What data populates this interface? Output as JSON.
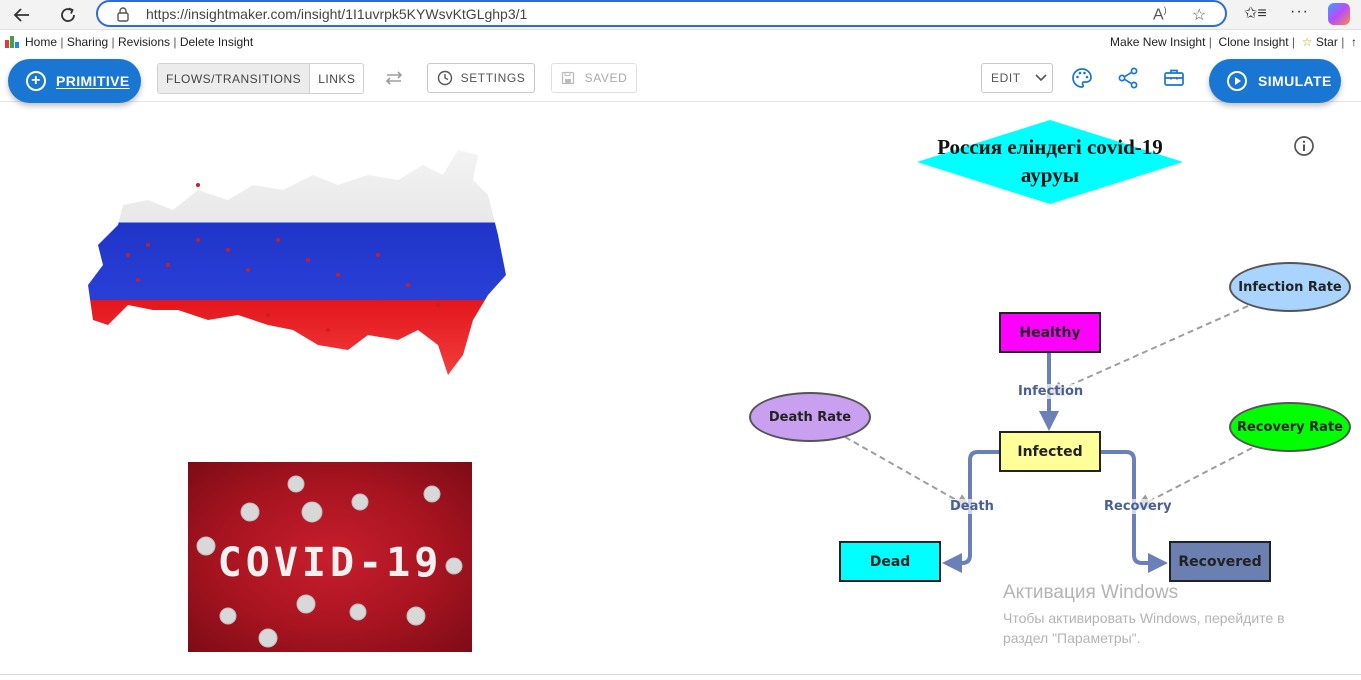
{
  "browser": {
    "url": "https://insightmaker.com/insight/1I1uvrpk5KYWsvKtGLghp3/1"
  },
  "links": {
    "left": [
      "Home",
      "Sharing",
      "Revisions",
      "Delete Insight"
    ],
    "right": [
      "Make New Insight",
      "Clone Insight",
      "Star"
    ],
    "star_symbol": "☆",
    "trailing": "↑"
  },
  "toolbar": {
    "primitive_label": "PRIMITIVE",
    "flows_label": "FLOWS/TRANSITIONS",
    "links_label": "LINKS",
    "settings_label": "SETTINGS",
    "saved_label": "SAVED",
    "edit_label": "EDIT",
    "simulate_label": "SIMULATE",
    "accent": "#1976d2"
  },
  "diagram": {
    "title": "Россия еліндегі covid-19 ауруы",
    "title_color": "#00ffff",
    "stocks": {
      "healthy": {
        "label": "Healthy",
        "color": "#ff00ff"
      },
      "infected": {
        "label": "Infected",
        "color": "#ffff99"
      },
      "dead": {
        "label": "Dead",
        "color": "#00ffff"
      },
      "recovered": {
        "label": "Recovered",
        "color": "#6b7fb0"
      }
    },
    "variables": {
      "infection_rate": {
        "label": "Infection Rate",
        "color": "#a8d4ff"
      },
      "death_rate": {
        "label": "Death Rate",
        "color": "#c9a0f0"
      },
      "recovery_rate": {
        "label": "Recovery Rate",
        "color": "#00ff00"
      }
    },
    "flows": {
      "infection": "Infection",
      "death": "Death",
      "recovery": "Recovery"
    }
  },
  "images": {
    "covid_text": "COVID-19"
  },
  "watermark": {
    "title": "Активация Windows",
    "body": "Чтобы активировать Windows, перейдите в раздел \"Параметры\"."
  }
}
